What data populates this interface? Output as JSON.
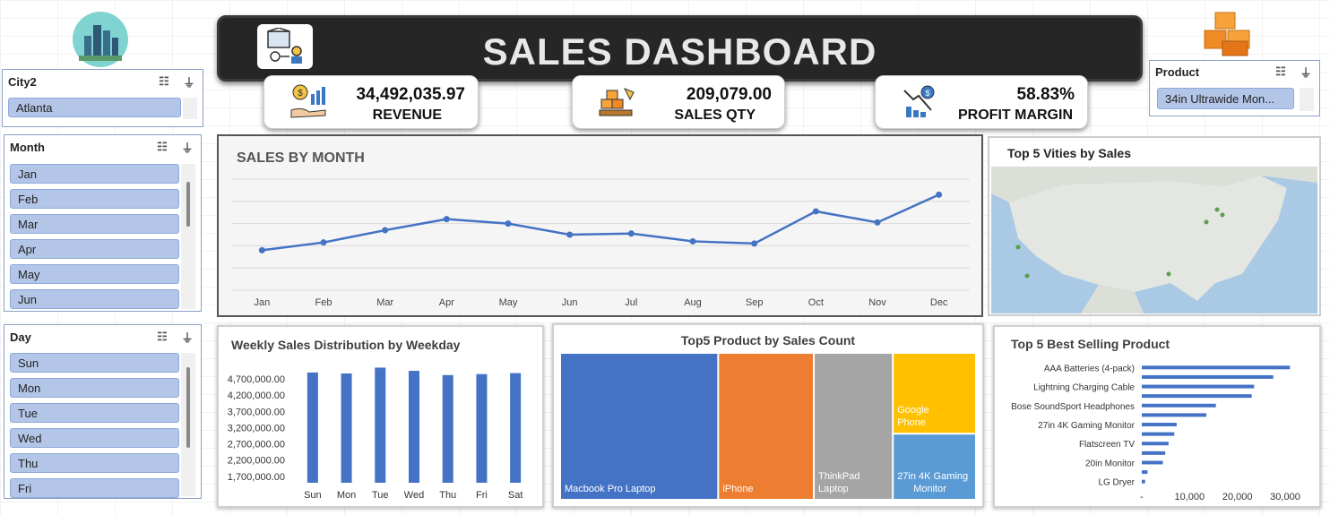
{
  "header": {
    "title": "SALES DASHBOARD"
  },
  "slicers": {
    "city": {
      "title": "City2",
      "items": [
        "Atlanta"
      ]
    },
    "month": {
      "title": "Month",
      "items": [
        "Jan",
        "Feb",
        "Mar",
        "Apr",
        "May",
        "Jun"
      ]
    },
    "day": {
      "title": "Day",
      "items": [
        "Sun",
        "Mon",
        "Tue",
        "Wed",
        "Thu",
        "Fri"
      ]
    },
    "product": {
      "title": "Product",
      "items": [
        "34in Ultrawide Mon..."
      ]
    }
  },
  "kpis": {
    "revenue": {
      "value": "34,492,035.97",
      "label": "REVENUE"
    },
    "sales_qty": {
      "value": "209,079.00",
      "label": "SALES QTY"
    },
    "profit_margin": {
      "value": "58.83%",
      "label": "PROFIT MARGIN"
    }
  },
  "map": {
    "title": "Top 5 Vities by Sales"
  },
  "colors": {
    "accent": "#4472c4",
    "orange": "#ed7d31",
    "gray": "#a5a5a5",
    "gold": "#ffc000",
    "lightblue": "#5b9bd5",
    "title_bg": "#262626"
  },
  "chart_data": [
    {
      "type": "line",
      "title": "SALES BY MONTH",
      "categories": [
        "Jan",
        "Feb",
        "Mar",
        "Apr",
        "May",
        "Jun",
        "Jul",
        "Aug",
        "Sep",
        "Oct",
        "Nov",
        "Dec"
      ],
      "values": [
        1.8,
        2.15,
        2.7,
        3.2,
        3.0,
        2.5,
        2.55,
        2.2,
        2.1,
        3.55,
        3.05,
        4.3
      ],
      "ylim": [
        0,
        5
      ],
      "grid": true,
      "color": "#4472c4"
    },
    {
      "type": "bar",
      "title": "Weekly Sales Distribution by Weekday",
      "categories": [
        "Sun",
        "Mon",
        "Tue",
        "Wed",
        "Thu",
        "Fri",
        "Sat"
      ],
      "values": [
        4900000,
        4870000,
        5050000,
        4950000,
        4820000,
        4850000,
        4880000
      ],
      "ytick_labels": [
        "4,700,000.00",
        "4,200,000.00",
        "3,700,000.00",
        "3,200,000.00",
        "2,700,000.00",
        "2,200,000.00",
        "1,700,000.00"
      ],
      "ytick_values": [
        4700000,
        4200000,
        3700000,
        3200000,
        2700000,
        2200000,
        1700000
      ],
      "ylim": [
        1500000,
        5200000
      ],
      "color": "#4472c4"
    },
    {
      "type": "treemap",
      "title": "Top5 Product by Sales Count",
      "items": [
        {
          "label": "Macbook Pro Laptop",
          "value": 38,
          "color": "#4472c4"
        },
        {
          "label": "iPhone",
          "value": 23,
          "color": "#ed7d31"
        },
        {
          "label": "ThinkPad Laptop",
          "value": 19,
          "color": "#a5a5a5"
        },
        {
          "label": "Google Phone",
          "value": 11,
          "color": "#ffc000"
        },
        {
          "label": "27in 4K Gaming Monitor",
          "value": 9,
          "color": "#5b9bd5"
        }
      ]
    },
    {
      "type": "bar-horizontal",
      "title": "Top 5 Best Selling Product",
      "categories": [
        "AAA Batteries (4-pack)",
        "",
        "Lightning Charging Cable",
        "",
        "Bose SoundSport Headphones",
        "",
        "27in 4K Gaming Monitor",
        "",
        "Flatscreen TV",
        "",
        "20in Monitor",
        "",
        "LG Dryer"
      ],
      "values": [
        31000,
        27500,
        23500,
        23000,
        15500,
        13500,
        7300,
        6800,
        5600,
        4900,
        4400,
        1200,
        700
      ],
      "xtick_labels": [
        "-",
        "10,000",
        "20,000",
        "30,000"
      ],
      "xtick_values": [
        0,
        10000,
        20000,
        30000
      ],
      "xlim": [
        0,
        33000
      ],
      "color": "#4472c4"
    }
  ]
}
